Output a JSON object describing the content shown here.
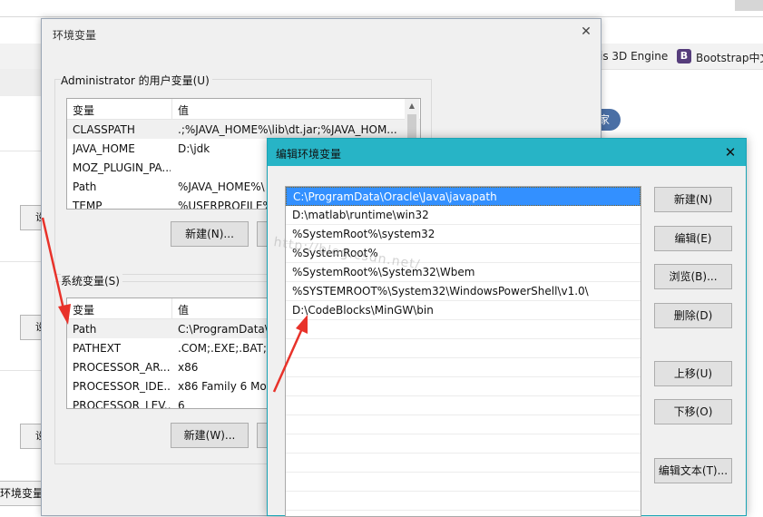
{
  "background_page": {
    "bookmarks": {
      "item1": "is 3D Engine",
      "item2_icon_letter": "B",
      "item2": "Bootstrap中文"
    },
    "button_fragment": "设",
    "tab_fragment": "环境变量",
    "pill_fragment": "家"
  },
  "env_dialog": {
    "title": "环境变量",
    "user_group_label": "Administrator 的用户变量(U)",
    "columns": {
      "var": "变量",
      "val": "值"
    },
    "user_vars": [
      {
        "name": "CLASSPATH",
        "value": ".;%JAVA_HOME%\\lib\\dt.jar;%JAVA_HOM..."
      },
      {
        "name": "JAVA_HOME",
        "value": "D:\\jdk"
      },
      {
        "name": "MOZ_PLUGIN_PA...",
        "value": ""
      },
      {
        "name": "Path",
        "value": "%JAVA_HOME%\\"
      },
      {
        "name": "TEMP",
        "value": "%USERPROFILE%"
      }
    ],
    "user_new_button": "新建(N)...",
    "system_group_label": "系统变量(S)",
    "system_vars": [
      {
        "name": "Path",
        "value": "C:\\ProgramData\\"
      },
      {
        "name": "PATHEXT",
        "value": ".COM;.EXE;.BAT;.C"
      },
      {
        "name": "PROCESSOR_AR...",
        "value": "x86"
      },
      {
        "name": "PROCESSOR_IDE...",
        "value": "x86 Family 6 Mod"
      },
      {
        "name": "PROCESSOR_LEV...",
        "value": "6"
      }
    ],
    "system_new_button": "新建(W)..."
  },
  "edit_dialog": {
    "title": "编辑环境变量",
    "paths": [
      "C:\\ProgramData\\Oracle\\Java\\javapath",
      "D:\\matlab\\runtime\\win32",
      "%SystemRoot%\\system32",
      "%SystemRoot%",
      "%SystemRoot%\\System32\\Wbem",
      "%SYSTEMROOT%\\System32\\WindowsPowerShell\\v1.0\\",
      "D:\\CodeBlocks\\MinGW\\bin"
    ],
    "selected_index": 0,
    "buttons": {
      "new": "新建(N)",
      "edit": "编辑(E)",
      "browse": "浏览(B)...",
      "delete": "删除(D)",
      "move_up": "上移(U)",
      "move_down": "下移(O)",
      "edit_text": "编辑文本(T)..."
    }
  },
  "watermark": "http://blog.csdn.net/",
  "annotation_color": "#e8322a"
}
